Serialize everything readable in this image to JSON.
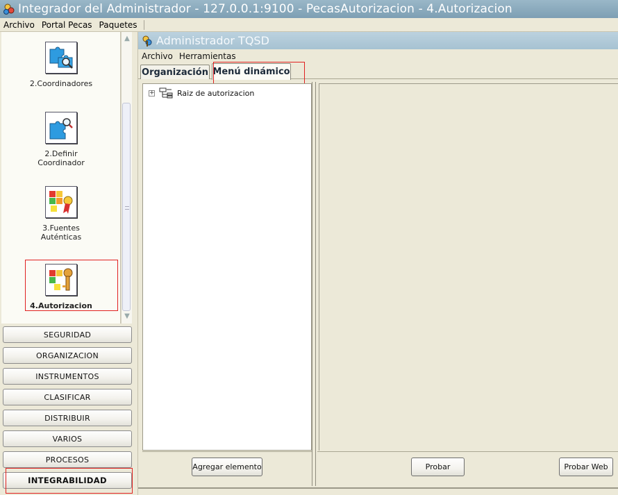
{
  "window": {
    "title": "Integrador del Administrador - 127.0.0.1:9100 - PecasAutorizacion - 4.Autorizacion"
  },
  "main_menu": {
    "items": [
      {
        "label": "Archivo"
      },
      {
        "label": "Portal Pecas"
      },
      {
        "label": "Paquetes"
      }
    ]
  },
  "left_panel": {
    "items": [
      {
        "label_line1": "2.Coordinadores",
        "label_line2": "",
        "icon": "puzzle-search-icon"
      },
      {
        "label_line1": "2.Definir",
        "label_line2": "Coordinador",
        "icon": "puzzle-search-icon"
      },
      {
        "label_line1": "3.Fuentes",
        "label_line2": "Auténticas",
        "icon": "puzzle-ribbon-icon"
      },
      {
        "label_line1": "4.Autorizacion",
        "label_line2": "",
        "icon": "puzzle-key-icon",
        "selected": true
      }
    ],
    "categories": [
      {
        "label": "SEGURIDAD"
      },
      {
        "label": "ORGANIZACION"
      },
      {
        "label": "INSTRUMENTOS"
      },
      {
        "label": "CLASIFICAR"
      },
      {
        "label": "DISTRIBUIR"
      },
      {
        "label": "VARIOS"
      },
      {
        "label": "PROCESOS"
      },
      {
        "label": "INTEGRABILIDAD",
        "active": true
      }
    ]
  },
  "inner_window": {
    "title": "Administrador TQSD",
    "menu": [
      {
        "label": "Archivo"
      },
      {
        "label": "Herramientas"
      }
    ],
    "tabs": [
      {
        "label": "Organización"
      },
      {
        "label": "Menú dinámico",
        "selected": true
      }
    ],
    "tree": {
      "root_label": "Raiz de autorizacion",
      "expander": "+"
    },
    "buttons": {
      "add_element": "Agregar elemento",
      "test": "Probar",
      "test_web": "Probar Web"
    }
  },
  "colors": {
    "title_bar": "#7d9fb3",
    "inner_title_bar": "#a6c2d2",
    "highlight": "#e02020",
    "window_bg": "#ece9d8"
  }
}
